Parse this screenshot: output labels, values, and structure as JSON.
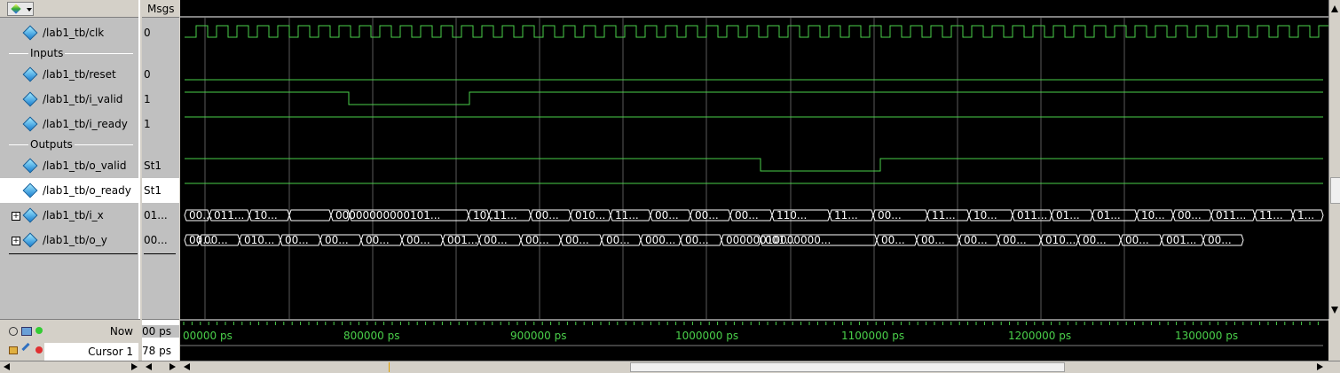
{
  "header": {
    "msgs_label": "Msgs"
  },
  "signals": [
    {
      "name": "/lab1_tb/clk",
      "value": "0"
    },
    {
      "name": "/lab1_tb/reset",
      "value": "0"
    },
    {
      "name": "/lab1_tb/i_valid",
      "value": "1"
    },
    {
      "name": "/lab1_tb/i_ready",
      "value": "1"
    },
    {
      "name": "/lab1_tb/o_valid",
      "value": "St1"
    },
    {
      "name": "/lab1_tb/o_ready",
      "value": "St1"
    },
    {
      "name": "/lab1_tb/i_x",
      "value": "01..."
    },
    {
      "name": "/lab1_tb/o_y",
      "value": "00..."
    }
  ],
  "dividers": {
    "inputs": "Inputs",
    "outputs": "Outputs"
  },
  "bus_values": {
    "i_x": [
      "00...",
      "011...",
      "10...",
      "",
      "00000000000101...",
      "",
      "10...",
      "11...",
      "00...",
      "010...",
      "11...",
      "00...",
      "00...",
      "00...",
      "110...",
      "11...",
      "00...",
      "11...",
      "10...",
      "011...",
      "01...",
      "01...",
      "10...",
      "00...",
      "011...",
      "11...",
      "1..."
    ],
    "o_y": [
      "00...",
      "00...",
      "010...",
      "00...",
      "00...",
      "00...",
      "00...",
      "001...",
      "00...",
      "00...",
      "00...",
      "00...",
      "000...",
      "00...",
      "00000010000000...",
      "001...",
      "00...",
      "00...",
      "00...",
      "00...",
      "010...",
      "00...",
      "00...",
      "001...",
      "00..."
    ]
  },
  "footer": {
    "now_label": "Now",
    "now_value": "00 ps",
    "cursor_label": "Cursor 1",
    "cursor_value": "78 ps"
  },
  "timeline": {
    "labels": [
      "00000 ps",
      "800000 ps",
      "900000 ps",
      "1000000 ps",
      "1100000 ps",
      "1200000 ps",
      "1300000 ps"
    ]
  },
  "colors": {
    "wave": "#4ad04a",
    "grid": "#5a5a5a",
    "bus_text": "#ffffff"
  }
}
